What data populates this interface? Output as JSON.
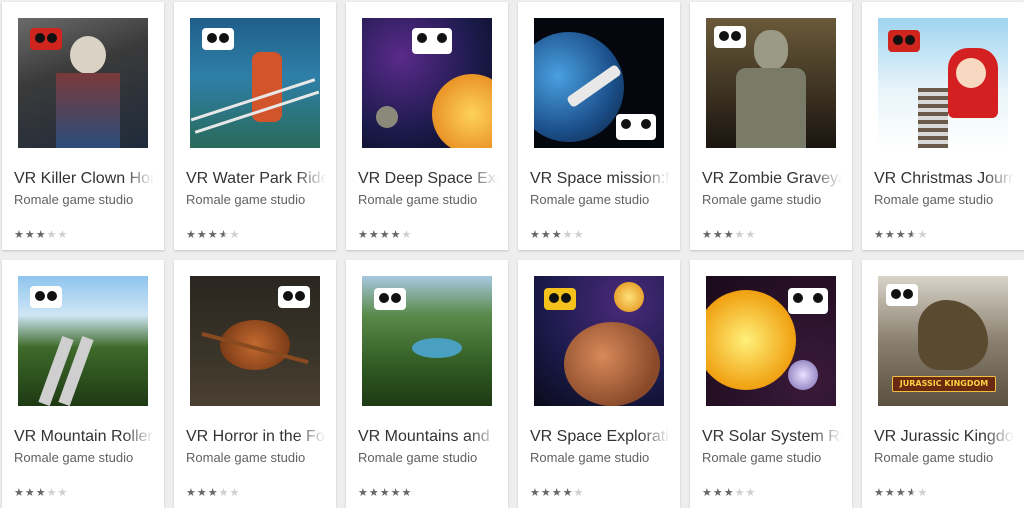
{
  "apps": [
    {
      "title": "VR Killer Clown Hor",
      "developer": "Romale game studio",
      "rating": 3,
      "vr_badge_color": "red"
    },
    {
      "title": "VR Water Park Ride",
      "developer": "Romale game studio",
      "rating": 3.5,
      "vr_badge_color": "white"
    },
    {
      "title": "VR Deep Space Exp",
      "developer": "Romale game studio",
      "rating": 4,
      "vr_badge_color": "white"
    },
    {
      "title": "VR Space mission:M",
      "developer": "Romale game studio",
      "rating": 3,
      "vr_badge_color": "white"
    },
    {
      "title": "VR Zombie Graveya",
      "developer": "Romale game studio",
      "rating": 3,
      "vr_badge_color": "white"
    },
    {
      "title": "VR Christmas Journ",
      "developer": "Romale game studio",
      "rating": 3.5,
      "vr_badge_color": "red"
    },
    {
      "title": "VR Mountain Roller",
      "developer": "Romale game studio",
      "rating": 3,
      "vr_badge_color": "white"
    },
    {
      "title": "VR Horror in the For",
      "developer": "Romale game studio",
      "rating": 3,
      "vr_badge_color": "white"
    },
    {
      "title": "VR Mountains and",
      "developer": "Romale game studio",
      "rating": 5,
      "vr_badge_color": "white"
    },
    {
      "title": "VR Space Exploratio",
      "developer": "Romale game studio",
      "rating": 4,
      "vr_badge_color": "yellow"
    },
    {
      "title": "VR Solar System Ro",
      "developer": "Romale game studio",
      "rating": 3,
      "vr_badge_color": "white"
    },
    {
      "title": "VR Jurassic Kingdo",
      "developer": "Romale game studio",
      "rating": 3.5,
      "vr_badge_color": "white"
    }
  ],
  "thumbnail_texts": {
    "jurassic_logo": "JURASSIC KINGDOM"
  },
  "colors": {
    "star_filled": "#666666",
    "star_empty": "#cfcfcf",
    "title": "#333333",
    "developer": "#616161"
  }
}
